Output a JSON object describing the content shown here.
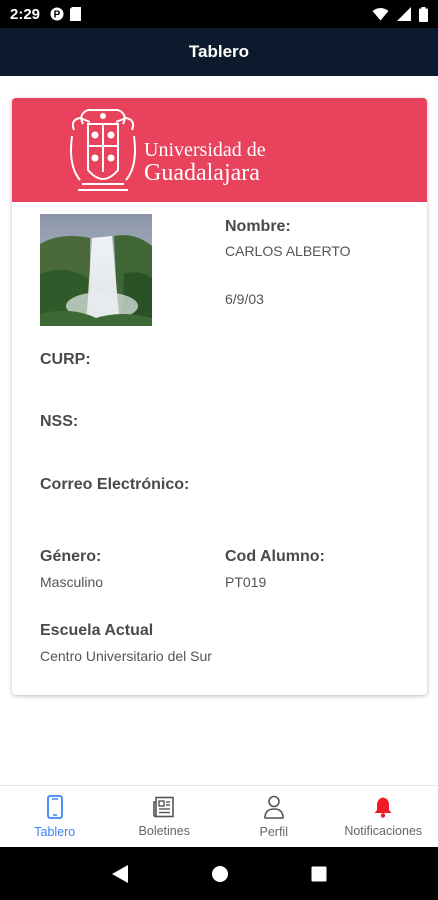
{
  "status_bar": {
    "time": "2:29",
    "icons": [
      "notification-p-icon",
      "sim-card-icon",
      "wifi-icon",
      "signal-icon",
      "battery-icon"
    ]
  },
  "app_bar": {
    "title": "Tablero"
  },
  "colors": {
    "app_bar": "#0c1a2e",
    "card_header": "#e9425c",
    "active_nav": "#3b82f6",
    "notification_bell": "#ee1c25"
  },
  "card": {
    "logo": {
      "line1": "Universidad de",
      "line2": "Guadalajara"
    },
    "photo": {
      "icon": "waterfall-photo"
    },
    "nombre": {
      "label": "Nombre:",
      "value": "CARLOS ALBERTO"
    },
    "fecha_nacimiento": "6/9/03",
    "curp": {
      "label": "CURP:"
    },
    "nss": {
      "label": "NSS:"
    },
    "correo": {
      "label": "Correo Electrónico:"
    },
    "genero": {
      "label": "Género:",
      "value": "Masculino"
    },
    "cod_alumno": {
      "label": "Cod Alumno:",
      "value": "PT019"
    },
    "escuela": {
      "label": "Escuela Actual",
      "value": "Centro Universitario del Sur"
    }
  },
  "bottom_nav": {
    "items": [
      {
        "label": "Tablero",
        "icon": "phone-icon",
        "active": true
      },
      {
        "label": "Boletines",
        "icon": "newspaper-icon",
        "active": false
      },
      {
        "label": "Perfil",
        "icon": "person-icon",
        "active": false
      },
      {
        "label": "Notificaciones",
        "icon": "bell-icon",
        "active": false
      }
    ]
  },
  "system_nav": {
    "icons": [
      "back-icon",
      "home-icon",
      "recents-icon"
    ]
  }
}
